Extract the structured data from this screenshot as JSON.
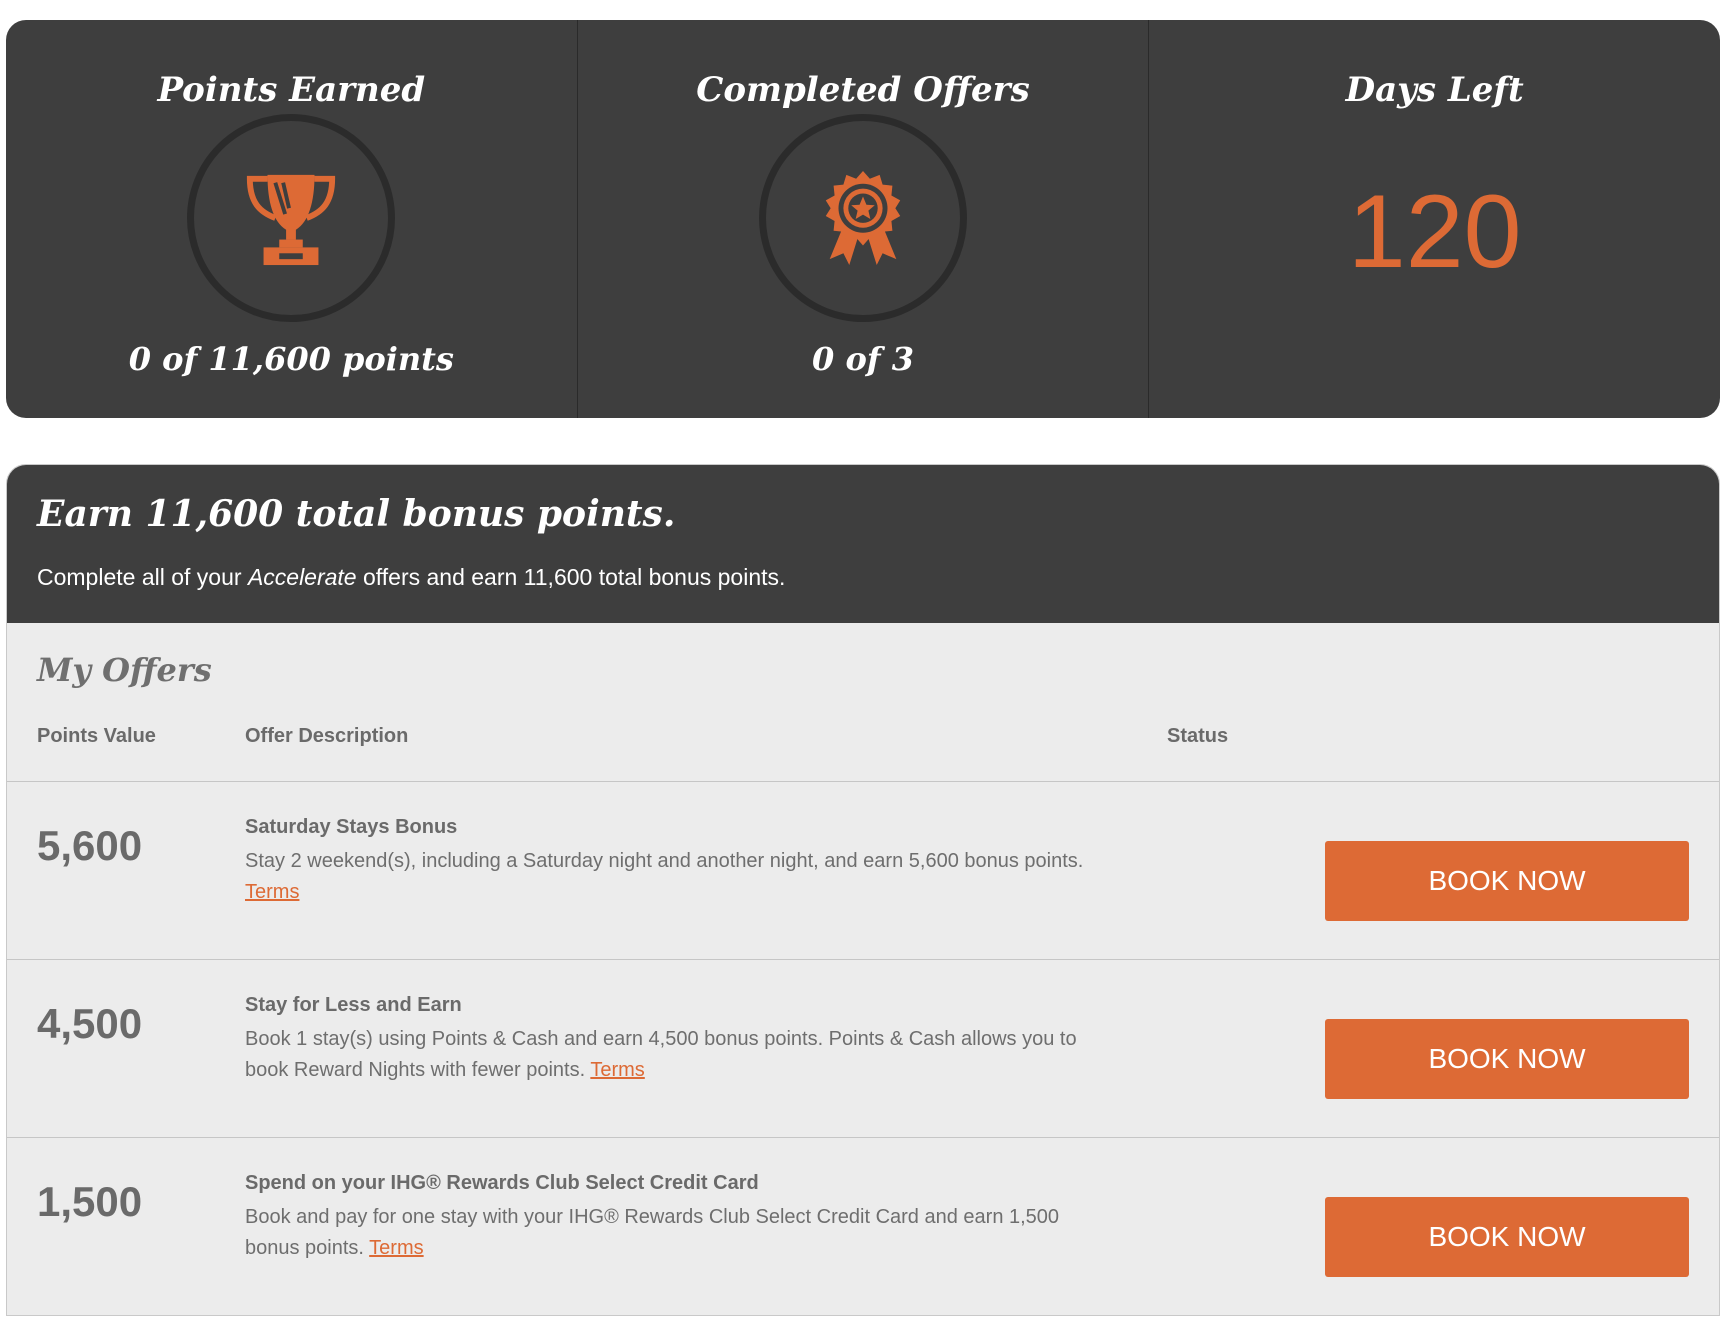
{
  "stats": {
    "points_earned": {
      "title": "Points Earned",
      "icon": "trophy-icon",
      "value": "0 of 11,600 points"
    },
    "completed_offers": {
      "title": "Completed Offers",
      "icon": "award-ribbon-icon",
      "value": "0 of 3"
    },
    "days_left": {
      "title": "Days Left",
      "value": "120"
    }
  },
  "promo": {
    "title": "Earn 11,600 total bonus points.",
    "subtitle_before": "Complete all of your ",
    "subtitle_em": "Accelerate",
    "subtitle_after": " offers and earn 11,600 total bonus points."
  },
  "my_offers": {
    "title": "My Offers",
    "columns": {
      "points": "Points Value",
      "description": "Offer Description",
      "status": "Status"
    },
    "items": [
      {
        "points": "5,600",
        "name": "Saturday Stays Bonus",
        "description": "Stay 2 weekend(s), including a Saturday night and another night, and earn 5,600 bonus points. ",
        "terms": "Terms",
        "button": "BOOK NOW"
      },
      {
        "points": "4,500",
        "name": "Stay for Less and Earn",
        "description": "Book 1 stay(s) using Points & Cash and earn 4,500 bonus points. Points & Cash allows you to book Reward Nights with fewer points. ",
        "terms": "Terms",
        "button": "BOOK NOW"
      },
      {
        "points": "1,500",
        "name": "Spend on your IHG® Rewards Club Select Credit Card",
        "description": "Book and pay for one stay with your IHG® Rewards Club Select Credit Card and earn 1,500 bonus points. ",
        "terms": "Terms",
        "button": "BOOK NOW"
      }
    ]
  },
  "colors": {
    "accent": "#dd6a35",
    "panel": "#3e3e3e",
    "background": "#ececec",
    "text_muted": "#6a6a6a"
  }
}
